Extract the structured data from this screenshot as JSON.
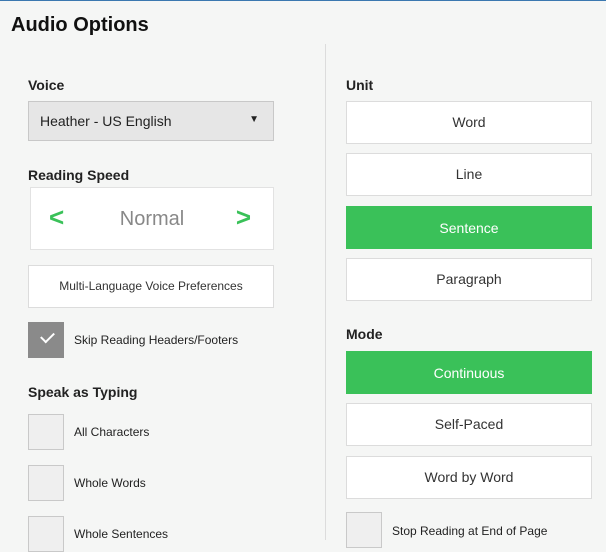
{
  "panel": {
    "title": "Audio Options"
  },
  "left": {
    "voice": {
      "label": "Voice",
      "selected": "Heather - US English"
    },
    "reading_speed": {
      "label": "Reading Speed",
      "value": "Normal"
    },
    "multilang_button": "Multi-Language Voice Preferences",
    "skip_headers": {
      "label": "Skip Reading Headers/Footers",
      "checked": true
    },
    "speak_as_typing": {
      "label": "Speak as Typing",
      "options": [
        {
          "label": "All Characters",
          "checked": false
        },
        {
          "label": "Whole Words",
          "checked": false
        },
        {
          "label": "Whole Sentences",
          "checked": false
        }
      ]
    }
  },
  "right": {
    "unit": {
      "label": "Unit",
      "options": [
        "Word",
        "Line",
        "Sentence",
        "Paragraph"
      ],
      "selected": "Sentence"
    },
    "mode": {
      "label": "Mode",
      "options": [
        "Continuous",
        "Self-Paced",
        "Word by Word"
      ],
      "selected": "Continuous"
    },
    "stop_reading": {
      "label": "Stop Reading at End of Page",
      "checked": false
    }
  },
  "colors": {
    "accent": "#3ac159",
    "checked_box": "#8a8a8a",
    "top_border": "#3b78b0"
  }
}
